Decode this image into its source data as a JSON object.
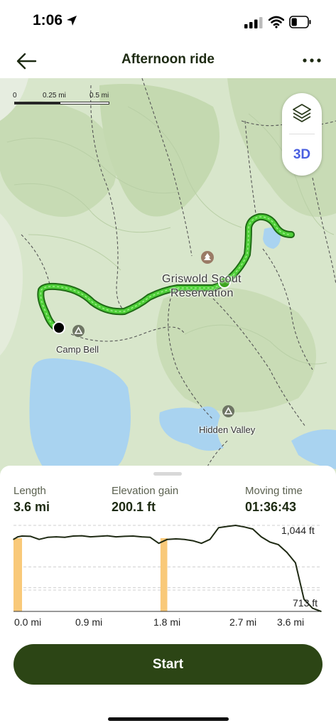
{
  "status_bar": {
    "time": "1:06",
    "battery_level": 0.35
  },
  "nav": {
    "title": "Afternoon ride"
  },
  "map": {
    "scale": {
      "zero": "0",
      "mid": "0.25 mi",
      "end": "0.5 mi"
    },
    "control_3d": "3D",
    "labels": {
      "reservation_line1": "Griswold Scout",
      "reservation_line2": "Reservation",
      "camp": "Camp Bell",
      "valley": "Hidden Valley"
    },
    "colors": {
      "land": "#d8e6cb",
      "forest": "#c9dcb5",
      "water": "#a9d3f0",
      "route": "#4ecf38",
      "route_outline": "#1f6b15"
    }
  },
  "stats": [
    {
      "label": "Length",
      "value": "3.6 mi"
    },
    {
      "label": "Elevation gain",
      "value": "200.1 ft"
    },
    {
      "label": "Moving time",
      "value": "01:36:43"
    }
  ],
  "chart_data": {
    "type": "area",
    "x": [
      0.0,
      0.05,
      0.1,
      0.2,
      0.3,
      0.4,
      0.5,
      0.6,
      0.7,
      0.8,
      0.9,
      1.0,
      1.1,
      1.2,
      1.3,
      1.4,
      1.5,
      1.6,
      1.7,
      1.8,
      1.9,
      2.0,
      2.1,
      2.2,
      2.3,
      2.4,
      2.5,
      2.6,
      2.7,
      2.8,
      2.9,
      3.0,
      3.1,
      3.2,
      3.3,
      3.4,
      3.5,
      3.6
    ],
    "y": [
      990,
      1000,
      1003,
      1002,
      990,
      998,
      1000,
      998,
      1003,
      1004,
      1000,
      1002,
      1004,
      1000,
      1002,
      1003,
      1000,
      998,
      975,
      990,
      992,
      990,
      985,
      975,
      990,
      1035,
      1040,
      1044,
      1038,
      1030,
      1000,
      980,
      970,
      940,
      900,
      760,
      725,
      713
    ],
    "xlabel": "",
    "ylabel": "",
    "xlim": [
      0,
      3.6
    ],
    "ylim": [
      713,
      1044
    ],
    "y_tick_labels": [
      "1,044 ft",
      "713 ft"
    ],
    "x_tick_labels": [
      "0.0 mi",
      "0.9 mi",
      "1.8 mi",
      "2.7 mi",
      "3.6 mi"
    ],
    "x_tick_values": [
      0.0,
      0.9,
      1.8,
      2.7,
      3.6
    ],
    "highlight_ranges": [
      [
        0.0,
        0.1
      ],
      [
        1.72,
        1.8
      ]
    ],
    "highlight_color": "#f9c979",
    "line_color": "#1f2a14",
    "grid": "dashed horizontal"
  },
  "actions": {
    "start": "Start"
  }
}
